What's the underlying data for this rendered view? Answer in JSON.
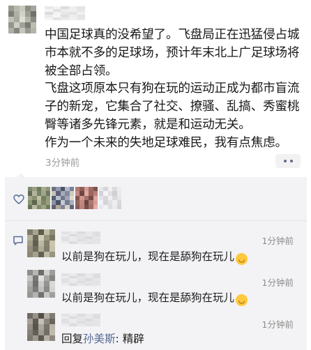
{
  "post": {
    "paragraphs": [
      "中国足球真的没希望了。飞盘局正在迅猛侵占城市本就不多的足球场，预计年末北上广足球场将被全部占领。",
      "飞盘这项原本只有狗在玩的运动正成为都市盲流子的新宠，它集合了社交、撩骚、乱搞、秀蜜桃臀等诸多先锋元素，就是和运动无关。",
      "作为一个未来的失地足球难民，我有点焦虑。"
    ],
    "time": "3分钟前"
  },
  "comments": [
    {
      "time": "1分钟前",
      "text": "以前是狗在玩儿，现在是舔狗在玩儿"
    },
    {
      "time": "1分钟前",
      "text": "以前是狗在玩儿，现在是舔狗在玩儿"
    },
    {
      "time": "1分钟前",
      "reply_prefix": "回复",
      "reply_to": "孙美斯",
      "reply_sep": ": ",
      "text": "精辟"
    }
  ],
  "icons": {
    "like": "heart-outline-icon",
    "comment": "speech-bubble-icon",
    "more": "more-dots-icon",
    "emoji": "grinning-sweat-emoji-icon"
  },
  "colors": {
    "link": "#576b95",
    "panel": "#f3f3f5",
    "meta_text": "#9a9a9a"
  }
}
